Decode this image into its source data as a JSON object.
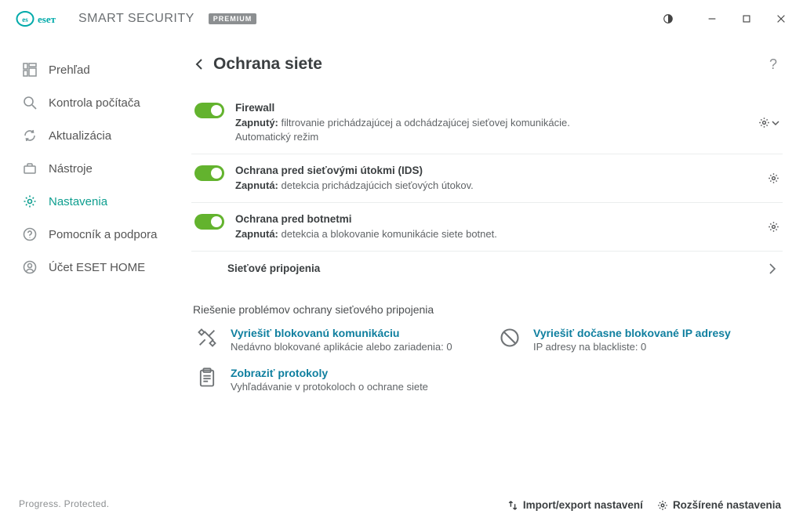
{
  "brand": {
    "name": "SMART SECURITY",
    "badge": "PREMIUM"
  },
  "sidebar": {
    "items": [
      {
        "label": "Prehľad",
        "icon": "dashboard-icon"
      },
      {
        "label": "Kontrola počítača",
        "icon": "magnifier-icon"
      },
      {
        "label": "Aktualizácia",
        "icon": "refresh-icon"
      },
      {
        "label": "Nástroje",
        "icon": "toolbox-icon"
      },
      {
        "label": "Nastavenia",
        "icon": "gear-icon",
        "active": true
      },
      {
        "label": "Pomocník a podpora",
        "icon": "help-icon"
      },
      {
        "label": "Účet ESET HOME",
        "icon": "user-icon"
      }
    ],
    "footer": "Progress. Protected."
  },
  "page": {
    "title": "Ochrana siete"
  },
  "rows": [
    {
      "title": "Firewall",
      "status": "Zapnutý:",
      "desc": "filtrovanie prichádzajúcej a odchádzajúcej sieťovej komunikácie.",
      "extra": "Automatický režim",
      "gearCaret": true
    },
    {
      "title": "Ochrana pred sieťovými útokmi (IDS)",
      "status": "Zapnutá:",
      "desc": "detekcia prichádzajúcich sieťových útokov.",
      "gearCaret": false
    },
    {
      "title": "Ochrana pred botnetmi",
      "status": "Zapnutá:",
      "desc": "detekcia a blokovanie komunikácie siete botnet.",
      "gearCaret": false
    }
  ],
  "linkRow": {
    "label": "Sieťové pripojenia"
  },
  "troubleshoot": {
    "heading": "Riešenie problémov ochrany sieťového pripojenia",
    "items": [
      {
        "title": "Vyriešiť blokovanú komunikáciu",
        "sub": "Nedávno blokované aplikácie alebo zariadenia: 0",
        "icon": "tools-icon"
      },
      {
        "title": "Vyriešiť dočasne blokované IP adresy",
        "sub": "IP adresy na blackliste: 0",
        "icon": "block-icon"
      },
      {
        "title": "Zobraziť protokoly",
        "sub": "Vyhľadávanie v protokoloch o ochrane siete",
        "icon": "clipboard-icon"
      }
    ]
  },
  "footer": {
    "import": "Import/export nastavení",
    "advanced": "Rozšírené nastavenia"
  }
}
